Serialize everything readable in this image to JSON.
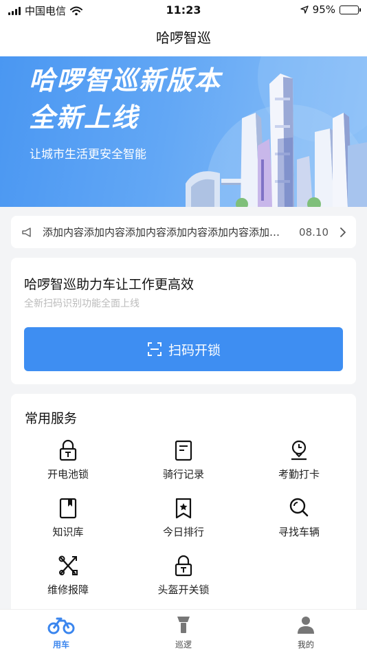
{
  "status_bar": {
    "carrier": "中国电信",
    "time": "11:23",
    "battery": "95%"
  },
  "nav": {
    "title": "哈啰智巡"
  },
  "banner": {
    "title_line1": "哈啰智巡新版本",
    "title_line2": "全新上线",
    "slogan": "让城市生活更安全智能"
  },
  "notice": {
    "text": "添加内容添加内容添加内容添加内容添加内容添加内容",
    "date": "08.10"
  },
  "promo": {
    "title": "哈啰智巡助力车让工作更高效",
    "subtitle": "全新扫码识别功能全面上线",
    "scan_label": "扫码开锁"
  },
  "services": {
    "title": "常用服务",
    "items": [
      {
        "label": "开电池锁",
        "icon": "lock-icon"
      },
      {
        "label": "骑行记录",
        "icon": "document-icon"
      },
      {
        "label": "考勤打卡",
        "icon": "clock-pin-icon"
      },
      {
        "label": "知识库",
        "icon": "book-icon"
      },
      {
        "label": "今日排行",
        "icon": "star-bookmark-icon"
      },
      {
        "label": "寻找车辆",
        "icon": "search-icon"
      },
      {
        "label": "维修报障",
        "icon": "tools-icon"
      },
      {
        "label": "头盔开关锁",
        "icon": "lock-icon"
      }
    ]
  },
  "tabs": [
    {
      "label": "用车",
      "icon": "bike-icon",
      "active": true
    },
    {
      "label": "巡逻",
      "icon": "flashlight-icon",
      "active": false
    },
    {
      "label": "我的",
      "icon": "user-icon",
      "active": false
    }
  ],
  "colors": {
    "accent": "#3e8ef2",
    "active_tab": "#3b86ee",
    "background": "#f3f4f6"
  }
}
